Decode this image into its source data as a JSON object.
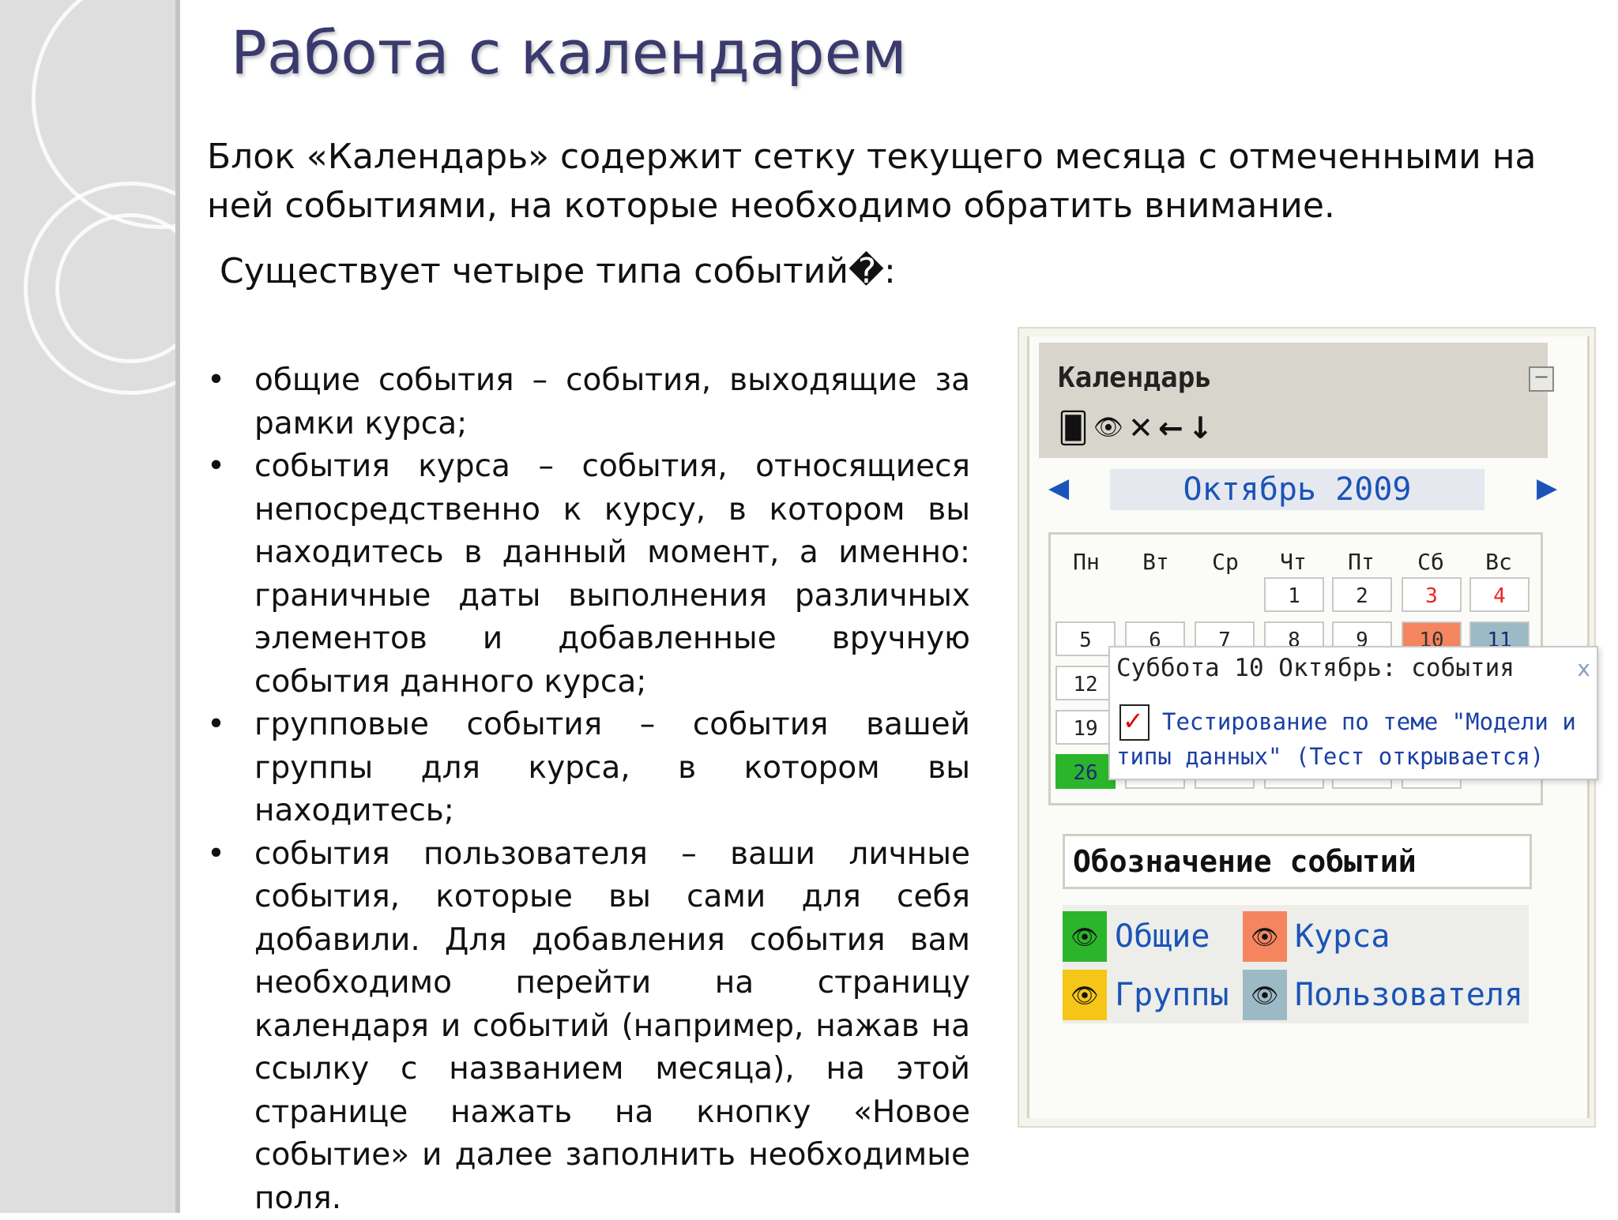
{
  "slide": {
    "title": "Работа с календарем",
    "intro": "Блок «Календарь» содержит сетку текущего месяца с отмеченными на ней событиями, на которые необходимо обратить внимание.",
    "types_heading": "Существует четыре типа событий�:",
    "bullet_symbol": "•",
    "bullets": [
      "общие события – события, выходящие за рамки курса;",
      "события курса – события, относящиеся непосредственно к курсу, в котором вы находитесь в данный момент, а именно: граничные даты выполнения различных элементов и добавленные вручную события данного курса;",
      "групповые события – события вашей группы для курса, в котором вы находитесь;",
      "события пользователя – ваши личные события, которые вы сами для себя добавили. Для добавления события вам необходимо перейти на страницу календаря и событий (например, нажав на ссылку с названием месяца), на этой странице нажать на кнопку «Новое событие» и далее заполнить необходимые поля."
    ]
  },
  "calendar": {
    "title": "Календарь",
    "collapse_symbol": "−",
    "toolbar_icons": [
      "move-icon",
      "eye-icon",
      "delete-icon",
      "left-arrow-icon",
      "down-arrow-icon"
    ],
    "toolbar_glyphs": [
      "🂠",
      "👁",
      "✕",
      "←",
      "↓"
    ],
    "prev_symbol": "◀",
    "next_symbol": "▶",
    "month": "Октябрь 2009",
    "weekdays": [
      "Пн",
      "Вт",
      "Ср",
      "Чт",
      "Пт",
      "Сб",
      "Вс"
    ],
    "days_row1": [
      "1",
      "2",
      "3",
      "4"
    ],
    "days_row2": [
      "5",
      "6",
      "7",
      "8",
      "9",
      "10",
      "11"
    ],
    "days_left": [
      "12",
      "19",
      "26"
    ],
    "colors": {
      "course": "#f4855e",
      "user": "#9cb9c6",
      "today": "#2bb52b",
      "general": "#2bb52b",
      "group": "#f5c518",
      "link": "#1a54b8"
    },
    "popup": {
      "title": "Суббота 10 Октябрь: события",
      "close_symbol": "x",
      "check_symbol": "✓",
      "event_link": "Тестирование по теме \"Модели и типы данных\" (Тест открывается)"
    },
    "legend": {
      "title": "Обозначение событий",
      "eye_symbol": "👁",
      "items": [
        "Общие",
        "Курса",
        "Группы",
        "Пользователя"
      ]
    }
  }
}
